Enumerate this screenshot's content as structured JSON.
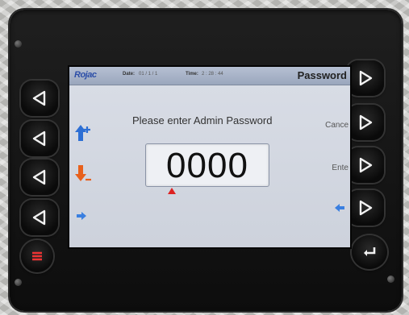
{
  "header": {
    "logo": "Rojac",
    "date_label": "Date:",
    "date_value": "01 / 1 / 1",
    "time_label": "Time:",
    "time_value": "2 : 28 : 44",
    "title": "Password"
  },
  "prompt": "Please enter Admin Password",
  "password_value": "0000",
  "right_labels": {
    "cancel": "Cance",
    "enter": "Ente"
  },
  "icons": {
    "increment": "arrow-up-plus-icon",
    "decrement": "arrow-down-minus-icon",
    "move_right": "arrow-right-icon",
    "move_left": "arrow-left-icon",
    "menu": "menu-icon",
    "enter": "return-icon"
  },
  "colors": {
    "up_arrow": "#2d6fd4",
    "down_arrow": "#e8601c",
    "caret": "#dd2222"
  }
}
